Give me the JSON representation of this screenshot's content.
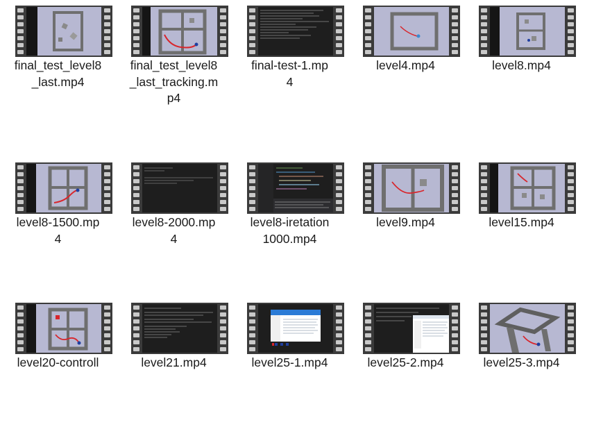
{
  "colors": {
    "film_frame": "#3b3b3b",
    "film_hole": "#c9c9c9",
    "sim_background": "#b7b8d2",
    "wall": "#6f6f6f",
    "terminal": "#1e1e1e",
    "trajectory": "#d8262c",
    "robot": "#1f3fa0"
  },
  "files": [
    {
      "name": "final_test_level8_last.mp4",
      "label_lines": [
        "final_test_level8",
        "_last.mp4"
      ],
      "thumb_icon": "maze-sim-thumbnail"
    },
    {
      "name": "final_test_level8_last_tracking.mp4",
      "label_lines": [
        "final_test_level8",
        "_last_tracking.m",
        "p4"
      ],
      "thumb_icon": "maze-tracking-thumbnail"
    },
    {
      "name": "final-test-1.mp4",
      "label_lines": [
        "final-test-1.mp",
        "4"
      ],
      "thumb_icon": "terminal-thumbnail"
    },
    {
      "name": "level4.mp4",
      "label_lines": [
        "level4.mp4"
      ],
      "thumb_icon": "maze-sim-thumbnail"
    },
    {
      "name": "level8.mp4",
      "label_lines": [
        "level8.mp4"
      ],
      "thumb_icon": "maze-sim-thumbnail"
    },
    {
      "name": "level8-1500.mp4",
      "label_lines": [
        "level8-1500.mp",
        "4"
      ],
      "thumb_icon": "maze-tracking-thumbnail"
    },
    {
      "name": "level8-2000.mp4",
      "label_lines": [
        "level8-2000.mp",
        "4"
      ],
      "thumb_icon": "terminal-thumbnail"
    },
    {
      "name": "level8-iretation1000.mp4",
      "label_lines": [
        "level8-iretation",
        "1000.mp4"
      ],
      "thumb_icon": "code-editor-thumbnail"
    },
    {
      "name": "level9.mp4",
      "label_lines": [
        "level9.mp4"
      ],
      "thumb_icon": "maze-tracking-thumbnail"
    },
    {
      "name": "level15.mp4",
      "label_lines": [
        "level15.mp4"
      ],
      "thumb_icon": "maze-tracking-thumbnail"
    },
    {
      "name": "level20-controll",
      "label_lines": [
        "level20-controll"
      ],
      "thumb_icon": "maze-tracking-thumbnail"
    },
    {
      "name": "level21.mp4",
      "label_lines": [
        "level21.mp4"
      ],
      "thumb_icon": "terminal-thumbnail"
    },
    {
      "name": "level25-1.mp4",
      "label_lines": [
        "level25-1.mp4"
      ],
      "thumb_icon": "file-manager-thumbnail"
    },
    {
      "name": "level25-2.mp4",
      "label_lines": [
        "level25-2.mp4"
      ],
      "thumb_icon": "file-manager-terminal-thumbnail"
    },
    {
      "name": "level25-3.mp4",
      "label_lines": [
        "level25-3.mp4"
      ],
      "thumb_icon": "3d-maze-thumbnail"
    }
  ]
}
